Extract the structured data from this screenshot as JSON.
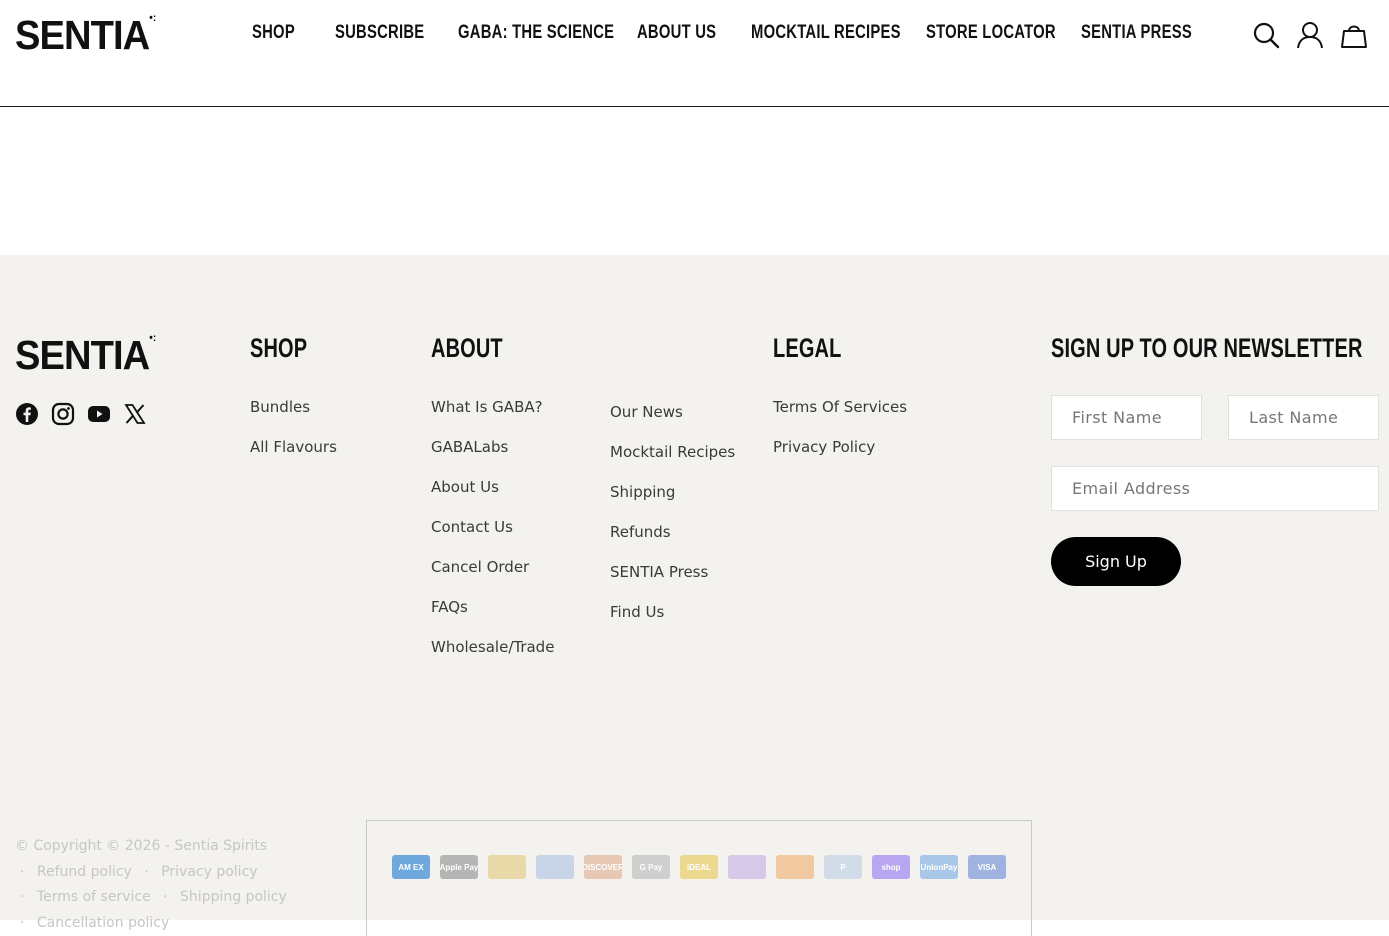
{
  "brand": {
    "name": "SENTIA",
    "mark": "•:"
  },
  "nav": [
    {
      "label": "SHOP"
    },
    {
      "label": "SUBSCRIBE"
    },
    {
      "label": "GABA: THE SCIENCE"
    },
    {
      "label": "ABOUT US"
    },
    {
      "label": "MOCKTAIL RECIPES"
    },
    {
      "label": "STORE LOCATOR"
    },
    {
      "label": "SENTIA PRESS"
    }
  ],
  "header_icons": [
    "search-icon",
    "account-icon",
    "cart-icon"
  ],
  "footer": {
    "social_icons": [
      "facebook-icon",
      "instagram-icon",
      "youtube-icon",
      "x-icon"
    ],
    "shop": {
      "title": "SHOP",
      "links": [
        "Bundles",
        "All Flavours"
      ]
    },
    "about": {
      "title": "ABOUT",
      "links_col1": [
        "What Is GABA?",
        "GABALabs",
        "About Us",
        "Contact Us",
        "Cancel Order",
        "FAQs",
        "Wholesale/Trade"
      ],
      "links_col2": [
        "Our News",
        "Mocktail Recipes",
        "Shipping",
        "Refunds",
        "SENTIA Press",
        "Find Us"
      ]
    },
    "legal": {
      "title": "LEGAL",
      "links": [
        "Terms Of Services",
        "Privacy Policy"
      ]
    },
    "newsletter": {
      "title": "SIGN UP TO OUR NEWSLETTER",
      "first_name_placeholder": "First Name",
      "last_name_placeholder": "Last Name",
      "email_placeholder": "Email Address",
      "button": "Sign Up"
    },
    "copyright": "© Copyright © 2026 - Sentia Spirits",
    "policies": {
      "refund": "Refund policy",
      "privacy": "Privacy policy",
      "terms": "Terms of service",
      "shipping": "Shipping policy",
      "cancellation": "Cancellation policy"
    },
    "payments": [
      {
        "name": "amex-icon",
        "label": "AM EX",
        "color": "#6fa8dc"
      },
      {
        "name": "apple-pay-icon",
        "label": "Apple Pay",
        "color": "#b5b5b5"
      },
      {
        "name": "bancontact-icon",
        "label": "",
        "color": "#e9d9a8"
      },
      {
        "name": "diners-club-icon",
        "label": "",
        "color": "#c8d4e8"
      },
      {
        "name": "discover-icon",
        "label": "DISCOVER",
        "color": "#e6c8b5"
      },
      {
        "name": "google-pay-icon",
        "label": "G Pay",
        "color": "#cfcfcf"
      },
      {
        "name": "ideal-icon",
        "label": "iDEAL",
        "color": "#ecd98f"
      },
      {
        "name": "maestro-icon",
        "label": "",
        "color": "#d6c8e8"
      },
      {
        "name": "mastercard-icon",
        "label": "",
        "color": "#f0c9a0"
      },
      {
        "name": "paypal-icon",
        "label": "P",
        "color": "#d2dbe8"
      },
      {
        "name": "shop-pay-icon",
        "label": "shop",
        "color": "#b9a6f0"
      },
      {
        "name": "unionpay-icon",
        "label": "UnionPay",
        "color": "#a9c8e8"
      },
      {
        "name": "visa-icon",
        "label": "VISA",
        "color": "#9fb2e0"
      }
    ]
  }
}
